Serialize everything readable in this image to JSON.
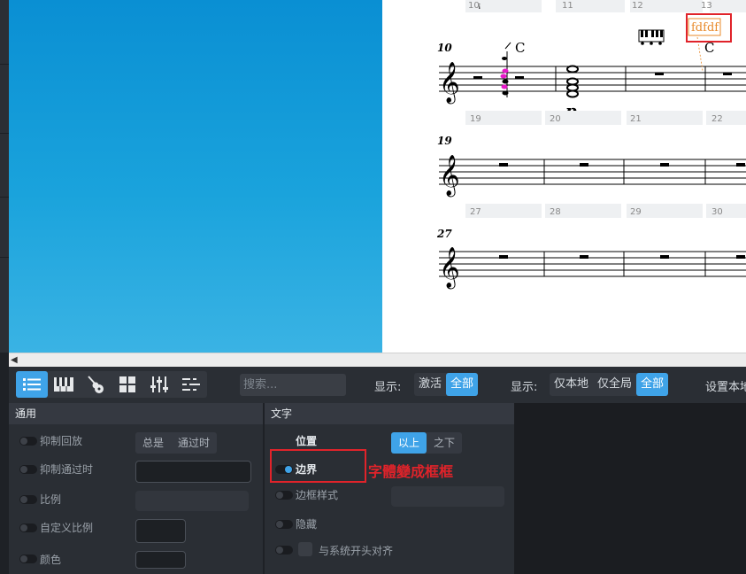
{
  "score": {
    "measure_numbers_top": [
      "10",
      "11",
      "12",
      "13"
    ],
    "system1_number": "10",
    "system2_number": "19",
    "system3_number": "27",
    "chord_label_1": "C",
    "chord_label_2": "C",
    "dynamic": "p",
    "text_annotation": "fdfdf",
    "row1_measures": [
      "19",
      "20",
      "21",
      "22"
    ],
    "row2_measures": [
      "27",
      "28",
      "29",
      "30"
    ]
  },
  "toolbar": {
    "icons": [
      "list-icon",
      "piano-icon",
      "guitar-icon",
      "grid-icon",
      "mixer-icon",
      "timeline-icon"
    ],
    "search_placeholder": "搜索...",
    "show_label_1": "显示:",
    "show_active": "激活",
    "show_all_1": "全部",
    "show_label_2": "显示:",
    "local_only": "仅本地",
    "global_only": "仅全局",
    "show_all_2": "全部",
    "set_local": "设置本地"
  },
  "general_panel": {
    "title": "通用",
    "suppress_playback": "抑制回放",
    "always": "总是",
    "when_passing": "通过时",
    "suppress_when_passing": "抑制通过时",
    "ratio": "比例",
    "custom_ratio": "自定义比例",
    "color": "颜色"
  },
  "text_panel": {
    "title": "文字",
    "position": "位置",
    "above": "以上",
    "below": "之下",
    "border": "边界",
    "border_style": "边框样式",
    "hide": "隐藏",
    "align_system_start": "与系统开头对齐"
  },
  "annotation": {
    "note": "字體變成框框",
    "color": "#e0232a"
  },
  "colors": {
    "accent": "#3fa3e8",
    "selection_note": "#e619c8",
    "text_orange": "#e8892a"
  }
}
